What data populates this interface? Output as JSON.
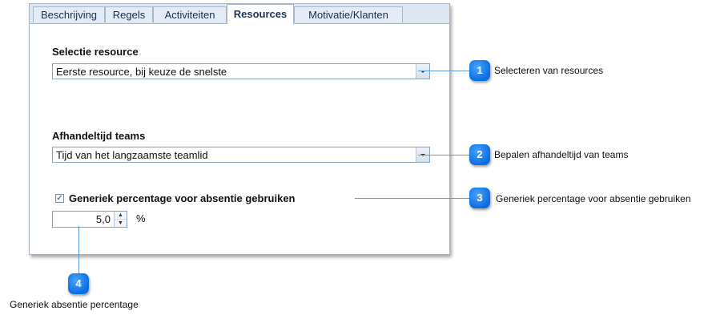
{
  "tabs": [
    {
      "label": "Beschrijving",
      "active": false
    },
    {
      "label": "Regels",
      "active": false
    },
    {
      "label": "Activiteiten",
      "active": false
    },
    {
      "label": "Resources",
      "active": true
    },
    {
      "label": "Motivatie/Klanten",
      "active": false
    }
  ],
  "resource_selection": {
    "label": "Selectie resource",
    "value": "Eerste resource, bij keuze de snelste"
  },
  "team_time": {
    "label": "Afhandeltijd teams",
    "value": "Tijd van het langzaamste teamlid"
  },
  "absence": {
    "checkbox_label": "Generiek percentage voor absentie gebruiken",
    "checked": true,
    "percentage": "5,0",
    "unit": "%"
  },
  "callouts": [
    {
      "number": "1",
      "text": "Selecteren van resources"
    },
    {
      "number": "2",
      "text": "Bepalen afhandeltijd van teams"
    },
    {
      "number": "3",
      "text": "Generiek percentage voor absentie gebruiken"
    },
    {
      "number": "4",
      "text": "Generiek absentie percentage"
    }
  ],
  "colors": {
    "accent": "#0a6fe0",
    "connector": "#5b9bd5",
    "tab_bar": "#dde7f2"
  }
}
